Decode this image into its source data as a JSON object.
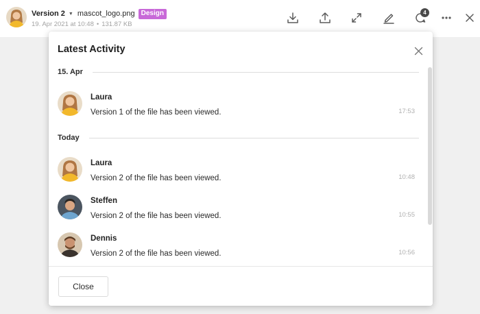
{
  "header": {
    "version_label": "Version 2",
    "file_name": "mascot_logo.png",
    "tag": "Design",
    "tag_color": "#c869d8",
    "meta_date": "19. Apr 2021 at 10:48",
    "meta_separator": "•",
    "meta_size": "131.87 KB",
    "comments_count": "4",
    "toolbar_icons": [
      "download-icon",
      "upload-icon",
      "expand-icon",
      "pen-icon",
      "comment-icon",
      "more-icon",
      "close-icon"
    ]
  },
  "modal": {
    "title": "Latest Activity",
    "groups": [
      {
        "date": "15. Apr",
        "items": [
          {
            "user": "Laura",
            "text": "Version 1 of the file has been viewed.",
            "time": "17:53"
          }
        ]
      },
      {
        "date": "Today",
        "items": [
          {
            "user": "Laura",
            "text": "Version 2 of the file has been viewed.",
            "time": "10:48"
          },
          {
            "user": "Steffen",
            "text": "Version 2 of the file has been viewed.",
            "time": "10:55"
          },
          {
            "user": "Dennis",
            "text": "Version 2 of the file has been viewed.",
            "time": "10:56"
          }
        ]
      }
    ],
    "close_label": "Close"
  }
}
